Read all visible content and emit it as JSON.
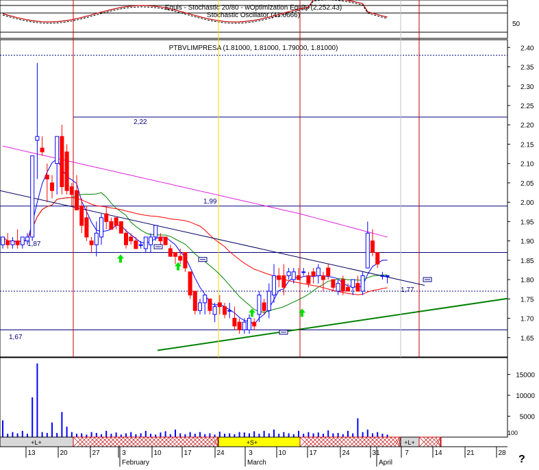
{
  "osc_panel": {
    "title": "Equis - Stochastic 20/80 - wOptimization Equity (2,252.43)",
    "subtitle": "Stochastic Oscillator (41.6666)",
    "tick_label": "50"
  },
  "price_panel": {
    "title": "PTBVLIMPRESA (1.81000, 1.81000, 1.79000, 1.81000)",
    "level_labels": [
      "2,22",
      "1,99",
      "1,87",
      "1,77",
      "1,67"
    ]
  },
  "volume_panel": {
    "tick_label": "100"
  },
  "help_glyph": "?",
  "markers": {
    "buy_arrow_icon": "green-up-arrow-icon",
    "sell_marker_icon": "exit-box-icon"
  },
  "colors": {
    "bull_candle": "#0000ff",
    "bear_candle": "#ff0000",
    "ma_short": "#0000ff",
    "ma_medium": "#008000",
    "ma_long": "#ff0000",
    "ma_longest": "#e020e0",
    "trendline": "#008000",
    "signal_line": "#c00000",
    "entry_line": "#ffd700"
  },
  "chart_data": [
    {
      "type": "line",
      "title": "Stochastic Oscillator (41.6666)",
      "y_ticks": [
        50
      ],
      "series": []
    },
    {
      "type": "candlestick",
      "title": "PTBVLIMPRESA (1.81000, 1.81000, 1.79000, 1.81000)",
      "ylim": [
        1.6,
        2.42
      ],
      "y_ticks": [
        1.65,
        1.7,
        1.75,
        1.8,
        1.85,
        1.9,
        1.95,
        2.0,
        2.05,
        2.1,
        2.15,
        2.2,
        2.25,
        2.3,
        2.35,
        2.4
      ],
      "x_tick_labels": [
        "13",
        "20",
        "27",
        "3",
        "10",
        "17",
        "24",
        "3",
        "10",
        "17",
        "24",
        "31",
        "7",
        "14",
        "21",
        "28"
      ],
      "month_labels": [
        "February",
        "March",
        "April"
      ],
      "horizontal_levels": [
        2.22,
        1.99,
        1.87,
        1.77,
        1.67
      ],
      "candles": [
        {
          "o": 1.89,
          "h": 1.91,
          "l": 1.88,
          "c": 1.91
        },
        {
          "o": 1.9,
          "h": 1.92,
          "l": 1.88,
          "c": 1.89
        },
        {
          "o": 1.89,
          "h": 1.91,
          "l": 1.88,
          "c": 1.9
        },
        {
          "o": 1.9,
          "h": 1.93,
          "l": 1.88,
          "c": 1.89
        },
        {
          "o": 1.89,
          "h": 1.91,
          "l": 1.88,
          "c": 1.91
        },
        {
          "o": 1.9,
          "h": 1.92,
          "l": 1.89,
          "c": 1.91
        },
        {
          "o": 1.91,
          "h": 2.12,
          "l": 1.9,
          "c": 2.12
        },
        {
          "o": 2.16,
          "h": 2.36,
          "l": 2.06,
          "c": 2.17
        },
        {
          "o": 2.14,
          "h": 2.17,
          "l": 2.12,
          "c": 2.13
        },
        {
          "o": 2.07,
          "h": 2.1,
          "l": 2.0,
          "c": 2.06
        },
        {
          "o": 2.05,
          "h": 2.07,
          "l": 2.01,
          "c": 2.03
        },
        {
          "o": 2.1,
          "h": 2.16,
          "l": 2.02,
          "c": 2.17
        },
        {
          "o": 2.17,
          "h": 2.2,
          "l": 2.02,
          "c": 2.04
        },
        {
          "o": 2.13,
          "h": 2.15,
          "l": 2.02,
          "c": 2.03
        },
        {
          "o": 2.04,
          "h": 2.05,
          "l": 1.99,
          "c": 2.02
        },
        {
          "o": 2.03,
          "h": 2.07,
          "l": 1.98,
          "c": 1.98
        },
        {
          "o": 1.99,
          "h": 2.01,
          "l": 1.92,
          "c": 1.94
        },
        {
          "o": 1.96,
          "h": 1.99,
          "l": 1.9,
          "c": 1.91
        },
        {
          "o": 1.9,
          "h": 1.91,
          "l": 1.87,
          "c": 1.89
        },
        {
          "o": 1.89,
          "h": 1.95,
          "l": 1.86,
          "c": 1.92
        },
        {
          "o": 1.91,
          "h": 1.97,
          "l": 1.89,
          "c": 1.96
        },
        {
          "o": 1.97,
          "h": 1.99,
          "l": 1.93,
          "c": 1.95
        },
        {
          "o": 1.95,
          "h": 1.96,
          "l": 1.93,
          "c": 1.93
        },
        {
          "o": 1.96,
          "h": 1.96,
          "l": 1.93,
          "c": 1.94
        },
        {
          "o": 1.95,
          "h": 1.95,
          "l": 1.92,
          "c": 1.92
        },
        {
          "o": 1.92,
          "h": 1.93,
          "l": 1.88,
          "c": 1.89
        },
        {
          "o": 1.91,
          "h": 1.92,
          "l": 1.89,
          "c": 1.9
        },
        {
          "o": 1.9,
          "h": 1.91,
          "l": 1.88,
          "c": 1.88
        },
        {
          "o": 1.89,
          "h": 1.9,
          "l": 1.88,
          "c": 1.89
        },
        {
          "o": 1.88,
          "h": 1.91,
          "l": 1.87,
          "c": 1.91
        },
        {
          "o": 1.89,
          "h": 1.92,
          "l": 1.87,
          "c": 1.91
        },
        {
          "o": 1.91,
          "h": 1.94,
          "l": 1.9,
          "c": 1.94
        },
        {
          "o": 1.91,
          "h": 1.92,
          "l": 1.89,
          "c": 1.9
        },
        {
          "o": 1.91,
          "h": 1.91,
          "l": 1.89,
          "c": 1.89
        },
        {
          "o": 1.88,
          "h": 1.89,
          "l": 1.86,
          "c": 1.86
        },
        {
          "o": 1.87,
          "h": 1.87,
          "l": 1.84,
          "c": 1.86
        },
        {
          "o": 1.86,
          "h": 1.88,
          "l": 1.84,
          "c": 1.85
        },
        {
          "o": 1.87,
          "h": 1.87,
          "l": 1.82,
          "c": 1.83
        },
        {
          "o": 1.82,
          "h": 1.82,
          "l": 1.75,
          "c": 1.76
        },
        {
          "o": 1.77,
          "h": 1.77,
          "l": 1.71,
          "c": 1.72
        },
        {
          "o": 1.72,
          "h": 1.75,
          "l": 1.71,
          "c": 1.74
        },
        {
          "o": 1.74,
          "h": 1.76,
          "l": 1.71,
          "c": 1.76
        },
        {
          "o": 1.75,
          "h": 1.75,
          "l": 1.71,
          "c": 1.72
        },
        {
          "o": 1.71,
          "h": 1.74,
          "l": 1.69,
          "c": 1.73
        },
        {
          "o": 1.74,
          "h": 1.76,
          "l": 1.71,
          "c": 1.73
        },
        {
          "o": 1.73,
          "h": 1.74,
          "l": 1.7,
          "c": 1.71
        },
        {
          "o": 1.72,
          "h": 1.74,
          "l": 1.7,
          "c": 1.72
        },
        {
          "o": 1.7,
          "h": 1.73,
          "l": 1.67,
          "c": 1.68
        },
        {
          "o": 1.69,
          "h": 1.7,
          "l": 1.66,
          "c": 1.67
        },
        {
          "o": 1.67,
          "h": 1.7,
          "l": 1.66,
          "c": 1.69
        },
        {
          "o": 1.67,
          "h": 1.71,
          "l": 1.66,
          "c": 1.7
        },
        {
          "o": 1.69,
          "h": 1.7,
          "l": 1.67,
          "c": 1.68
        },
        {
          "o": 1.71,
          "h": 1.77,
          "l": 1.69,
          "c": 1.76
        },
        {
          "o": 1.74,
          "h": 1.75,
          "l": 1.71,
          "c": 1.72
        },
        {
          "o": 1.72,
          "h": 1.79,
          "l": 1.7,
          "c": 1.77
        },
        {
          "o": 1.76,
          "h": 1.84,
          "l": 1.74,
          "c": 1.81
        },
        {
          "o": 1.81,
          "h": 1.83,
          "l": 1.78,
          "c": 1.8
        },
        {
          "o": 1.81,
          "h": 1.84,
          "l": 1.76,
          "c": 1.78
        },
        {
          "o": 1.81,
          "h": 1.83,
          "l": 1.8,
          "c": 1.82
        },
        {
          "o": 1.8,
          "h": 1.83,
          "l": 1.79,
          "c": 1.82
        },
        {
          "o": 1.81,
          "h": 1.83,
          "l": 1.8,
          "c": 1.8
        },
        {
          "o": 1.82,
          "h": 1.83,
          "l": 1.81,
          "c": 1.82
        },
        {
          "o": 1.81,
          "h": 1.82,
          "l": 1.78,
          "c": 1.79
        },
        {
          "o": 1.82,
          "h": 1.83,
          "l": 1.79,
          "c": 1.81
        },
        {
          "o": 1.81,
          "h": 1.84,
          "l": 1.79,
          "c": 1.83
        },
        {
          "o": 1.81,
          "h": 1.82,
          "l": 1.77,
          "c": 1.8
        },
        {
          "o": 1.83,
          "h": 1.84,
          "l": 1.8,
          "c": 1.81
        },
        {
          "o": 1.8,
          "h": 1.8,
          "l": 1.77,
          "c": 1.78
        },
        {
          "o": 1.77,
          "h": 1.8,
          "l": 1.76,
          "c": 1.79
        },
        {
          "o": 1.8,
          "h": 1.81,
          "l": 1.76,
          "c": 1.77
        },
        {
          "o": 1.78,
          "h": 1.79,
          "l": 1.77,
          "c": 1.77
        },
        {
          "o": 1.78,
          "h": 1.8,
          "l": 1.76,
          "c": 1.8
        },
        {
          "o": 1.79,
          "h": 1.81,
          "l": 1.77,
          "c": 1.77
        },
        {
          "o": 1.77,
          "h": 1.82,
          "l": 1.76,
          "c": 1.81
        },
        {
          "o": 1.83,
          "h": 1.95,
          "l": 1.83,
          "c": 1.92
        },
        {
          "o": 1.9,
          "h": 1.93,
          "l": 1.86,
          "c": 1.87
        },
        {
          "o": 1.87,
          "h": 1.87,
          "l": 1.83,
          "c": 1.84
        },
        {
          "o": 1.81,
          "h": 1.82,
          "l": 1.8,
          "c": 1.81
        },
        {
          "o": 1.81,
          "h": 1.81,
          "l": 1.79,
          "c": 1.81
        }
      ],
      "series": []
    },
    {
      "type": "bar",
      "title": "",
      "y_ticks": [
        5000,
        10000,
        15000
      ],
      "x_tick_labels": [
        "13",
        "20",
        "27",
        "3",
        "10",
        "17",
        "24",
        "3",
        "10",
        "17",
        "24",
        "31",
        "7",
        "14",
        "21",
        "28"
      ],
      "signal_labels": [
        "+L+",
        "+S+",
        "+L+"
      ],
      "values": [
        4000,
        800,
        1200,
        900,
        1500,
        800,
        9500,
        17600,
        1200,
        1000,
        3500,
        1000,
        6000,
        2500,
        1200,
        800,
        900,
        600,
        1200,
        1000,
        700,
        1500,
        800,
        1100,
        600,
        900,
        1200,
        700,
        900,
        1500,
        800,
        600,
        1100,
        1400,
        700,
        1800,
        900,
        700,
        1200,
        800,
        1200,
        700,
        900,
        600,
        1300,
        800,
        900,
        700,
        1200,
        1100,
        900,
        1400,
        800,
        1500,
        900,
        1800,
        800,
        1200,
        900,
        700,
        1500,
        800,
        1200,
        900,
        1100,
        800,
        1600,
        900,
        1000,
        700,
        1500,
        900,
        4500,
        1200,
        1800,
        900,
        1200,
        800,
        600
      ]
    }
  ]
}
